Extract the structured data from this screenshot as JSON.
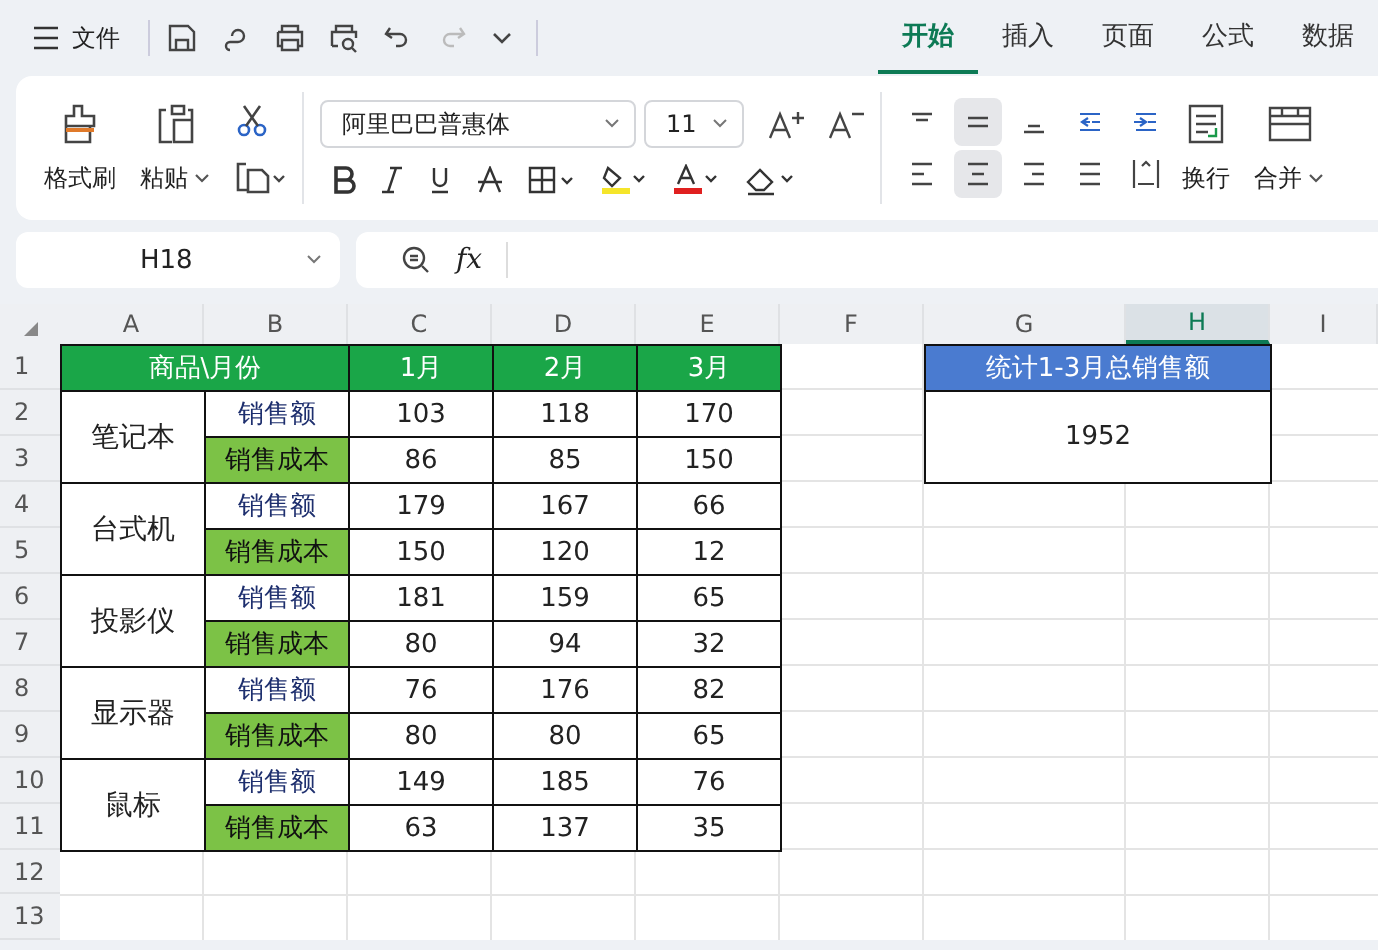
{
  "menu": {
    "label": "文件"
  },
  "tabs": [
    {
      "label": "开始",
      "selected": true
    },
    {
      "label": "插入",
      "selected": false
    },
    {
      "label": "页面",
      "selected": false
    },
    {
      "label": "公式",
      "selected": false
    },
    {
      "label": "数据",
      "selected": false
    }
  ],
  "ribbon": {
    "format_painter": "格式刷",
    "paste": "粘贴",
    "font": "阿里巴巴普惠体",
    "font_size": "11",
    "wrap": "换行",
    "merge": "合并",
    "vertical_align": [
      {
        "selected": false
      },
      {
        "selected": true
      },
      {
        "selected": false
      }
    ],
    "horizontal_align": [
      {
        "selected": false
      },
      {
        "selected": true
      },
      {
        "selected": false
      },
      {
        "selected": false
      }
    ]
  },
  "formula_bar": {
    "name_box": "H18",
    "fx": "fx"
  },
  "sheet": {
    "columns": [
      {
        "label": "A",
        "selected": false
      },
      {
        "label": "B",
        "selected": false
      },
      {
        "label": "C",
        "selected": false
      },
      {
        "label": "D",
        "selected": false
      },
      {
        "label": "E",
        "selected": false
      },
      {
        "label": "F",
        "selected": false
      },
      {
        "label": "G",
        "selected": false
      },
      {
        "label": "H",
        "selected": true
      },
      {
        "label": "I",
        "selected": false
      }
    ],
    "rows": [
      "1",
      "2",
      "3",
      "4",
      "5",
      "6",
      "7",
      "8",
      "9",
      "10",
      "11",
      "12",
      "13"
    ],
    "header": [
      "商品\\月份",
      "1月",
      "2月",
      "3月"
    ],
    "products": [
      {
        "name": "笔记本",
        "lines": [
          {
            "kind": "sales",
            "label": "销售额",
            "values": [
              "103",
              "118",
              "170"
            ]
          },
          {
            "kind": "cost",
            "label": "销售成本",
            "values": [
              "86",
              "85",
              "150"
            ]
          }
        ]
      },
      {
        "name": "台式机",
        "lines": [
          {
            "kind": "sales",
            "label": "销售额",
            "values": [
              "179",
              "167",
              "66"
            ]
          },
          {
            "kind": "cost",
            "label": "销售成本",
            "values": [
              "150",
              "120",
              "12"
            ]
          }
        ]
      },
      {
        "name": "投影仪",
        "lines": [
          {
            "kind": "sales",
            "label": "销售额",
            "values": [
              "181",
              "159",
              "65"
            ]
          },
          {
            "kind": "cost",
            "label": "销售成本",
            "values": [
              "80",
              "94",
              "32"
            ]
          }
        ]
      },
      {
        "name": "显示器",
        "lines": [
          {
            "kind": "sales",
            "label": "销售额",
            "values": [
              "76",
              "176",
              "82"
            ]
          },
          {
            "kind": "cost",
            "label": "销售成本",
            "values": [
              "80",
              "80",
              "65"
            ]
          }
        ]
      },
      {
        "name": "鼠标",
        "lines": [
          {
            "kind": "sales",
            "label": "销售额",
            "values": [
              "149",
              "185",
              "76"
            ]
          },
          {
            "kind": "cost",
            "label": "销售成本",
            "values": [
              "63",
              "137",
              "35"
            ]
          }
        ]
      }
    ],
    "summary": {
      "title": "统计1-3月总销售额",
      "value": "1952"
    }
  }
}
